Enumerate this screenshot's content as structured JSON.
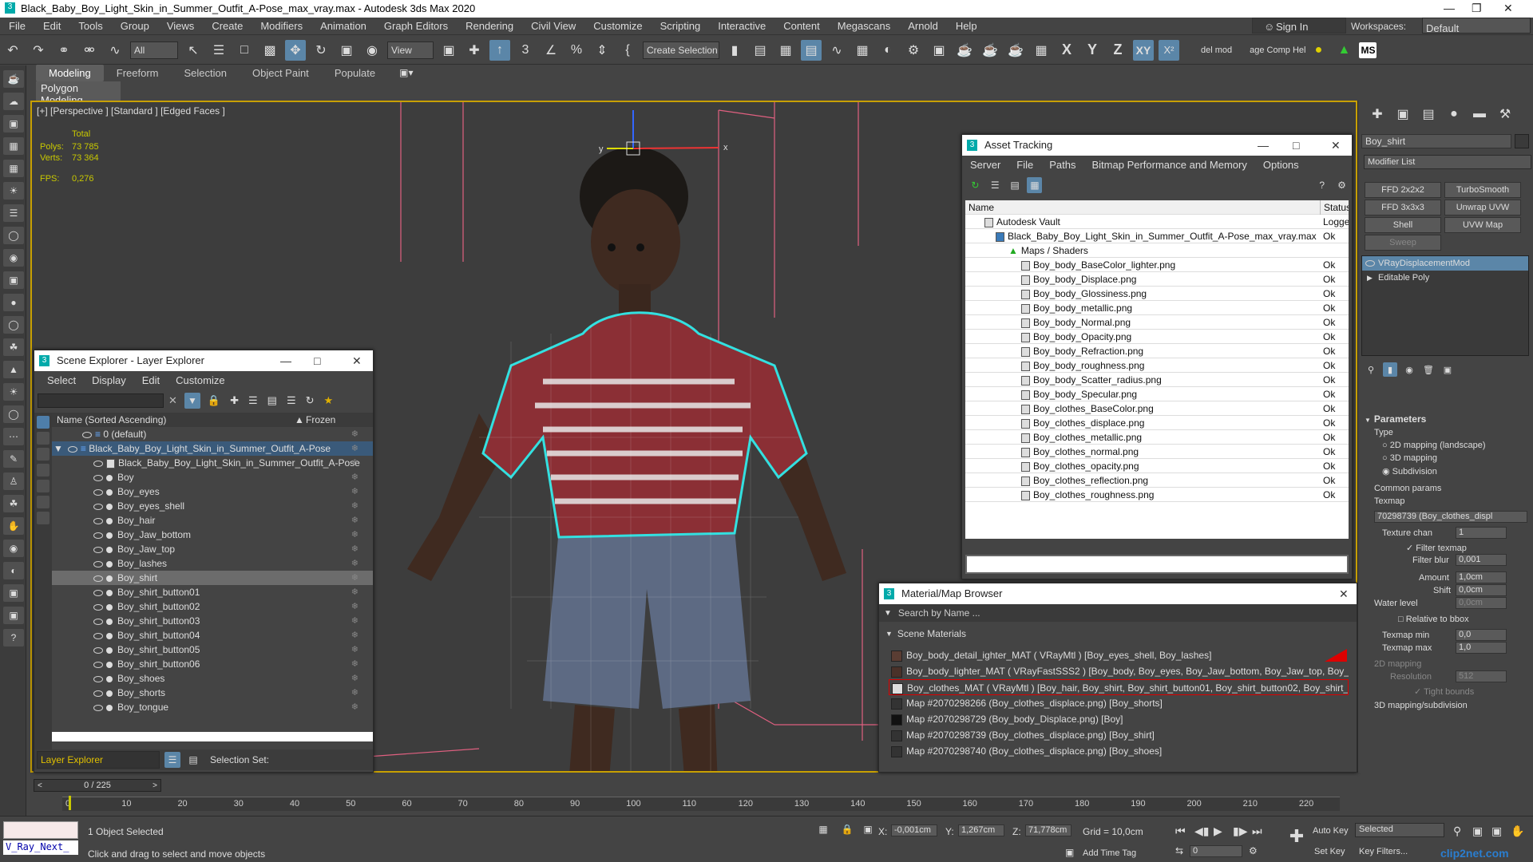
{
  "window": {
    "title": "Black_Baby_Boy_Light_Skin_in_Summer_Outfit_A-Pose_max_vray.max - Autodesk 3ds Max 2020"
  },
  "menu": [
    "File",
    "Edit",
    "Tools",
    "Group",
    "Views",
    "Create",
    "Modifiers",
    "Animation",
    "Graph Editors",
    "Rendering",
    "Civil View",
    "Customize",
    "Scripting",
    "Interactive",
    "Content",
    "Megascans",
    "Arnold",
    "Help"
  ],
  "account": {
    "sign_in": "Sign In",
    "workspaces_label": "Workspaces:",
    "workspace": "Default"
  },
  "toolbar": {
    "filter": "All",
    "view": "View",
    "selection_set": "Create Selection Se",
    "axes": [
      "X",
      "Y",
      "Z",
      "XY"
    ],
    "del_mod": "del mod",
    "comp_help": "age Comp Hel",
    "ms": "MS"
  },
  "ribbon": {
    "tabs": [
      "Modeling",
      "Freeform",
      "Selection",
      "Object Paint",
      "Populate"
    ],
    "active": "Modeling",
    "sub": "Polygon Modeling"
  },
  "viewport": {
    "label": "[+] [Perspective ] [Standard ] [Edged Faces ]",
    "total": "Total",
    "polys_label": "Polys:",
    "polys": "73 785",
    "verts_label": "Verts:",
    "verts": "73 364",
    "fps_label": "FPS:",
    "fps": "0,276",
    "axis_x": "x",
    "axis_y": "y"
  },
  "scene_explorer": {
    "title": "Scene Explorer - Layer Explorer",
    "menu": [
      "Select",
      "Display",
      "Edit",
      "Customize"
    ],
    "col_name": "Name (Sorted Ascending)",
    "col_frozen": "Frozen",
    "items": [
      "0 (default)",
      "Black_Baby_Boy_Light_Skin_in_Summer_Outfit_A-Pose",
      "Black_Baby_Boy_Light_Skin_in_Summer_Outfit_A-Pose",
      "Boy",
      "Boy_eyes",
      "Boy_eyes_shell",
      "Boy_hair",
      "Boy_Jaw_bottom",
      "Boy_Jaw_top",
      "Boy_lashes",
      "Boy_shirt",
      "Boy_shirt_button01",
      "Boy_shirt_button02",
      "Boy_shirt_button03",
      "Boy_shirt_button04",
      "Boy_shirt_button05",
      "Boy_shirt_button06",
      "Boy_shoes",
      "Boy_shorts",
      "Boy_tongue"
    ],
    "footer": "Layer Explorer",
    "selection_set": "Selection Set:"
  },
  "asset_tracking": {
    "title": "Asset Tracking",
    "menu": [
      "Server",
      "File",
      "Paths",
      "Bitmap Performance and Memory",
      "Options"
    ],
    "col_name": "Name",
    "col_status": "Status",
    "vault": "Autodesk Vault",
    "vault_status": "Logge",
    "file": "Black_Baby_Boy_Light_Skin_in_Summer_Outfit_A-Pose_max_vray.max",
    "file_status": "Ok",
    "maps": "Maps / Shaders",
    "maps_list": [
      "Boy_body_BaseColor_lighter.png",
      "Boy_body_Displace.png",
      "Boy_body_Glossiness.png",
      "Boy_body_metallic.png",
      "Boy_body_Normal.png",
      "Boy_body_Opacity.png",
      "Boy_body_Refraction.png",
      "Boy_body_roughness.png",
      "Boy_body_Scatter_radius.png",
      "Boy_body_Specular.png",
      "Boy_clothes_BaseColor.png",
      "Boy_clothes_displace.png",
      "Boy_clothes_metallic.png",
      "Boy_clothes_normal.png",
      "Boy_clothes_opacity.png",
      "Boy_clothes_reflection.png",
      "Boy_clothes_roughness.png"
    ],
    "ok": "Ok"
  },
  "material_browser": {
    "title": "Material/Map Browser",
    "search": "Search by Name ...",
    "section": "Scene Materials",
    "items": [
      "Boy_body_detail_ighter_MAT ( VRayMtl ) [Boy_eyes_shell, Boy_lashes]",
      "Boy_body_lighter_MAT ( VRayFastSSS2 ) [Boy_body, Boy_eyes, Boy_Jaw_bottom, Boy_Jaw_top, Boy_tongue]",
      "Boy_clothes_MAT ( VRayMtl ) [Boy_hair, Boy_shirt, Boy_shirt_button01, Boy_shirt_button02, Boy_shirt_b...",
      "Map #2070298266 (Boy_clothes_displace.png) [Boy_shorts]",
      "Map #2070298729 (Boy_body_Displace.png) [Boy]",
      "Map #2070298739 (Boy_clothes_displace.png) [Boy_shirt]",
      "Map #2070298740 (Boy_clothes_displace.png) [Boy_shoes]"
    ]
  },
  "command_panel": {
    "object_name": "Boy_shirt",
    "modifier_list": "Modifier List",
    "buttons": [
      "FFD 2x2x2",
      "TurboSmooth",
      "FFD 3x3x3",
      "Unwrap UVW",
      "Shell",
      "UVW Map",
      "Sweep"
    ],
    "stack": [
      "VRayDisplacementMod",
      "Editable Poly"
    ],
    "params_title": "Parameters",
    "type_label": "Type",
    "types": [
      "2D mapping (landscape)",
      "3D mapping",
      "Subdivision"
    ],
    "common": "Common params",
    "texmap": "Texmap",
    "texmap_value": "70298739 (Boy_clothes_displ",
    "texture_chan_label": "Texture chan",
    "texture_chan": "1",
    "filter_texmap": "Filter texmap",
    "filter_blur_label": "Filter blur",
    "filter_blur": "0,001",
    "amount_label": "Amount",
    "amount": "1,0cm",
    "shift_label": "Shift",
    "shift": "0,0cm",
    "water_label": "Water level",
    "water": "0,0cm",
    "relative": "Relative to bbox",
    "texmap_min_label": "Texmap min",
    "texmap_min": "0,0",
    "texmap_max_label": "Texmap max",
    "texmap_max": "1,0",
    "mapping2d": "2D mapping",
    "resolution_label": "Resolution",
    "resolution": "512",
    "tight": "Tight bounds",
    "mapping3d": "3D mapping/subdivision"
  },
  "timeline": {
    "frame": "0 / 225",
    "ticks": [
      "0",
      "10",
      "20",
      "30",
      "40",
      "50",
      "60",
      "70",
      "80",
      "90",
      "100",
      "110",
      "120",
      "130",
      "140",
      "150",
      "160",
      "170",
      "180",
      "190",
      "200",
      "210",
      "220"
    ]
  },
  "status": {
    "script": "V_Ray_Next_",
    "selected": "1 Object Selected",
    "hint": "Click and drag to select and move objects",
    "x_label": "X:",
    "x": "-0,001cm",
    "y_label": "Y:",
    "y": "1,267cm",
    "z_label": "Z:",
    "z": "71,778cm",
    "grid": "Grid = 10,0cm",
    "add_time_tag": "Add Time Tag",
    "auto_key": "Auto Key",
    "set_key": "Set Key",
    "key_mode": "Selected",
    "key_filters": "Key Filters...",
    "frame_field": "0",
    "watermark": "clip2net.com"
  }
}
